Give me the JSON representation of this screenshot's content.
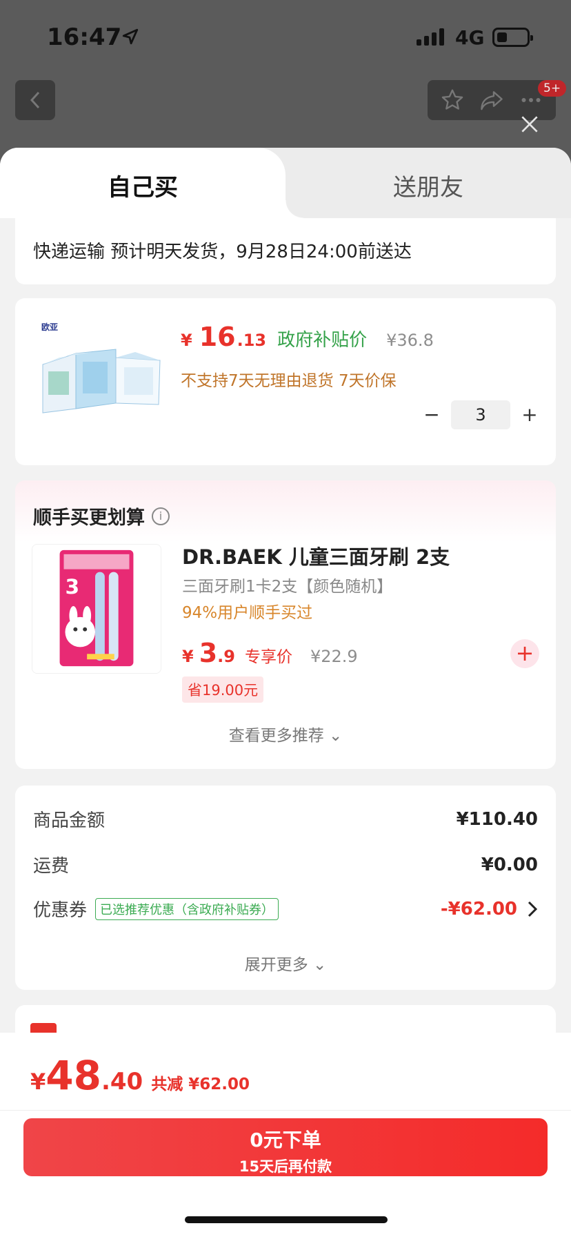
{
  "status_bar": {
    "time": "16:47",
    "network": "4G"
  },
  "nav": {
    "badge": "5+"
  },
  "tabs": [
    {
      "label": "自己买",
      "active": true
    },
    {
      "label": "送朋友",
      "active": false
    }
  ],
  "shipping": {
    "text": "快递运输 预计明天发货，9月28日24:00前送达"
  },
  "product": {
    "brand_text": "欧亚",
    "currency": "¥",
    "price_int": "16",
    "price_dec": ".13",
    "price_tag": "政府补贴价",
    "original_price": "¥36.8",
    "policy": "不支持7天无理由退货  7天价保",
    "quantity": "3",
    "minus": "−",
    "plus": "+"
  },
  "recommend": {
    "title": "顺手买更划算",
    "info": "i",
    "name": "DR.BAEK 儿童三面牙刷 2支",
    "spec": "三面牙刷1卡2支【颜色随机】",
    "stat": "94%用户顺手买过",
    "currency": "¥",
    "price_int": "3",
    "price_dec": ".9",
    "price_tag": "专享价",
    "original_price": "¥22.9",
    "save": "省19.00元",
    "add": "+",
    "more": "查看更多推荐 ⌄"
  },
  "summary": {
    "goods_label": "商品金额",
    "goods_value": "¥110.40",
    "shipping_label": "运费",
    "shipping_value": "¥0.00",
    "coupon_label": "优惠券",
    "coupon_tag": "已选推荐优惠（含政府补贴券）",
    "coupon_value": "-¥62.00",
    "expand": "展开更多 ⌄"
  },
  "footer": {
    "currency": "¥",
    "total_int": "48",
    "total_dec": ".40",
    "reduced": "共减 ¥62.00",
    "pay_main": "0元下单",
    "pay_sub": "15天后再付款"
  },
  "colors": {
    "accent_red": "#e8322b",
    "green": "#35a24a",
    "orange": "#c0752a"
  }
}
